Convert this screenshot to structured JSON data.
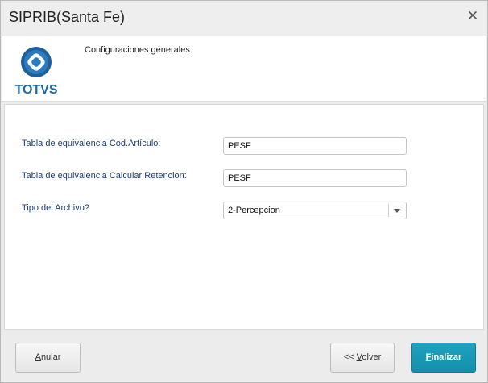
{
  "window": {
    "title": "SIPRIB(Santa Fe)",
    "close_glyph": "✕"
  },
  "header": {
    "logo_text": "TOTVS",
    "section_label": "Configuraciones generales:"
  },
  "form": {
    "fields": [
      {
        "label": "Tabla de equivalencia Cod.Artículo:",
        "value": "PESF"
      },
      {
        "label": "Tabla de equivalencia Calcular Retencion:",
        "value": "PESF"
      }
    ],
    "select": {
      "label": "Tipo del Archivo?",
      "value": "2-Percepcion"
    }
  },
  "footer": {
    "cancel": {
      "first": "A",
      "rest": "nular"
    },
    "back": {
      "prefix": "<< ",
      "first": "V",
      "rest": "olver"
    },
    "finish": {
      "first": "F",
      "rest": "inalizar"
    }
  },
  "colors": {
    "accent": "#1a9bb8",
    "label": "#1c3d7a",
    "logo": "#1f6aa5"
  }
}
